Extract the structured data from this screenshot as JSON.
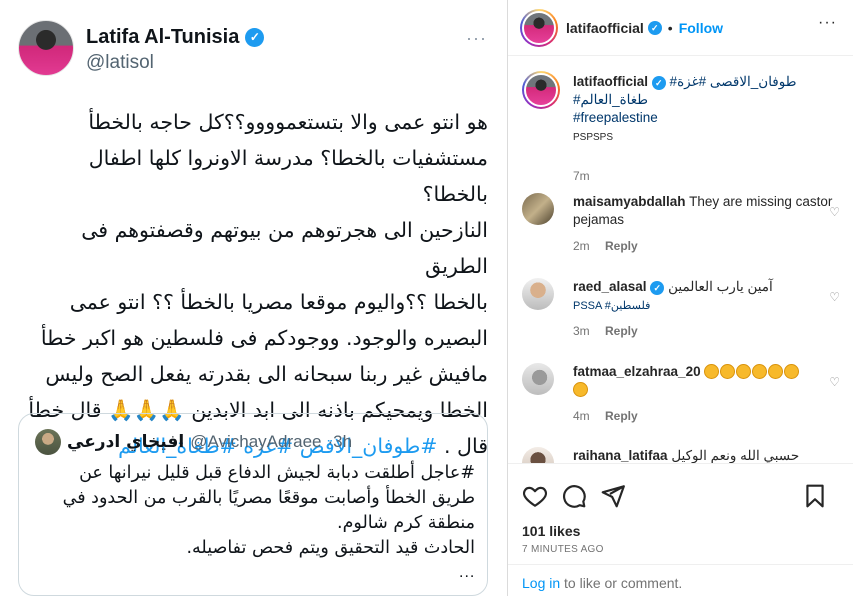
{
  "tweet": {
    "author_name": "Latifa Al-Tunisia",
    "handle": "@latisol",
    "more": "···",
    "body_lines": [
      "هو انتو عمى والا بتستعموووو؟؟كل حاجه بالخطأ",
      "مستشفيات بالخطا؟  مدرسة الاونروا كلها اطفال بالخطا؟",
      "النازحين الى هجرتوهم من بيوتهم وقصفتوهم فى الطريق",
      "بالخطا ؟؟واليوم موقعا مصريا بالخطأ ؟؟ انتو عمى",
      "البصيره والوجود.  ووجودكم فى فلسطين هو اكبر خطأ",
      "مافيش غير ربنا سبحانه الى بقدرته يفعل الصح وليس",
      "الخطا ويمحيكم باذنه الى ابد الابدين 🙏🙏🙏 قال خطأ"
    ],
    "last_line_prefix": "قال .",
    "hashtags": "#طوفان_الاقص #غزه #طغاة_العالم",
    "quote": {
      "name": "افيخاي ادرعي",
      "handle": "@AvichayAdraee",
      "time": "·3h",
      "body_lines": [
        "#عاجل أطلقت دبابة لجيش الدفاع قبل قليل نيرانها عن",
        "طريق الخطأ وأصابت موقعًا مصريًا بالقرب من الحدود في",
        "منطقة كرم شالوم.",
        "الحادث قيد التحقيق ويتم فحص تفاصيله."
      ],
      "more": "..."
    }
  },
  "instagram": {
    "header": {
      "username": "latifaofficial",
      "dot": "•",
      "follow_label": "Follow",
      "menu": "···"
    },
    "caption": {
      "username": "latifaofficial",
      "text_line1": "#طوفان_الاقصى #غزة",
      "text_line2": "#طغاة_العالم",
      "text_line3": "#freepalestine",
      "text_line4": "PSPSPS",
      "time": "7m"
    },
    "comments": [
      {
        "user": "maisamyabdallah",
        "text": "They are missing castor pejamas",
        "time": "2m",
        "reply": "Reply"
      },
      {
        "user": "raed_alasal",
        "text": "آمين يارب العالمين",
        "text2": "PSSA #فلسطين",
        "time": "3m",
        "reply": "Reply"
      },
      {
        "user": "fatmaa_elzahraa_20",
        "text": "",
        "time": "4m",
        "reply": "Reply"
      },
      {
        "user": "raihana_latifaa",
        "text": "حسبي الله ونعم الوكيل",
        "time": "",
        "reply": ""
      }
    ],
    "likes": "101 likes",
    "ago": "7 MINUTES AGO",
    "login_link": "Log in",
    "login_rest": " to like or comment."
  }
}
